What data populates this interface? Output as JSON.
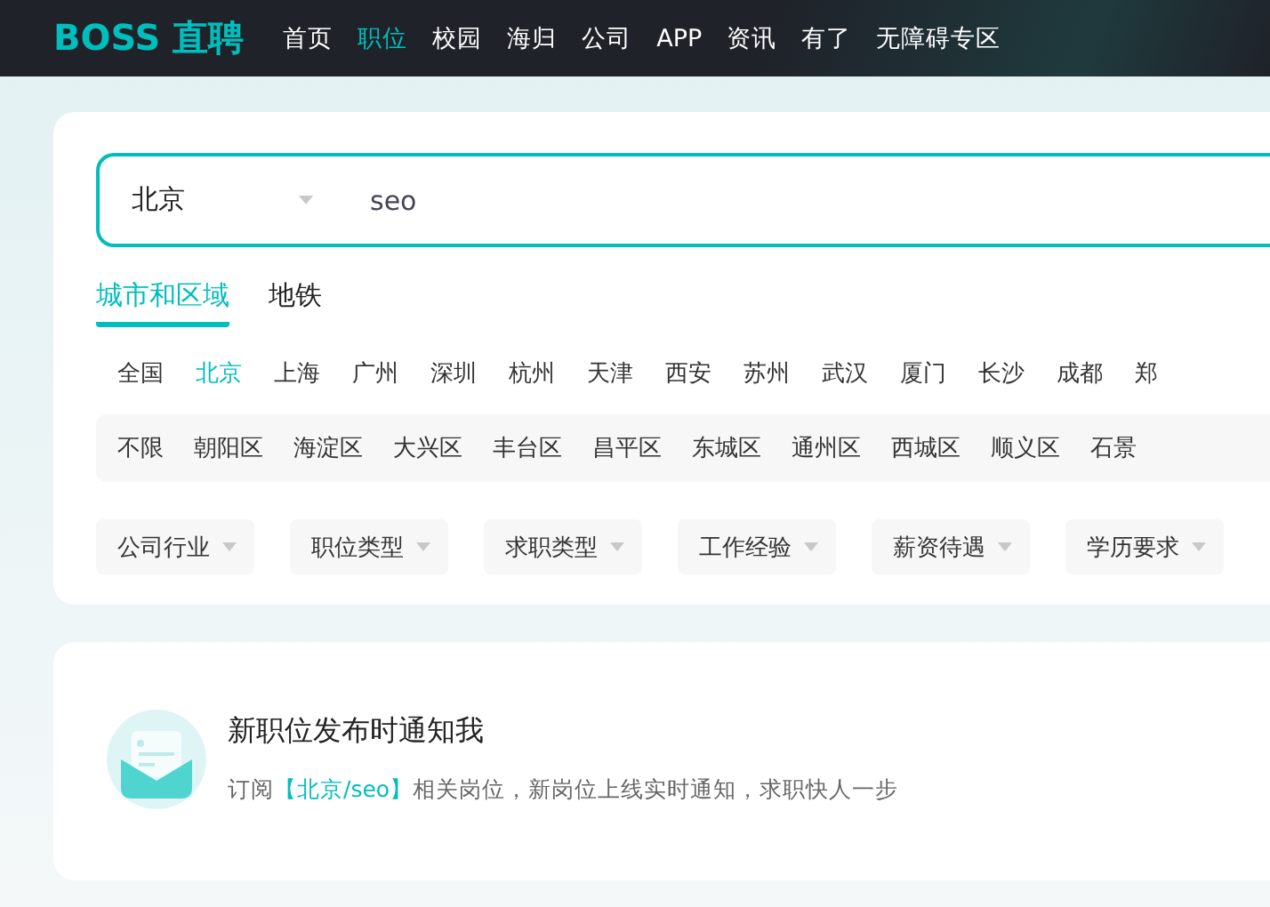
{
  "header": {
    "logo": "BOSS 直聘",
    "nav": [
      {
        "label": "首页",
        "selected": false
      },
      {
        "label": "职位",
        "selected": true
      },
      {
        "label": "校园",
        "selected": false
      },
      {
        "label": "海归",
        "selected": false
      },
      {
        "label": "公司",
        "selected": false
      },
      {
        "label": "APP",
        "selected": false
      },
      {
        "label": "资讯",
        "selected": false
      },
      {
        "label": "有了",
        "selected": false
      },
      {
        "label": "无障碍专区",
        "selected": false
      }
    ]
  },
  "search": {
    "city": "北京",
    "value": "seo"
  },
  "tabs": [
    {
      "label": "城市和区域",
      "selected": true
    },
    {
      "label": "地铁",
      "selected": false
    }
  ],
  "cities": [
    {
      "label": "全国",
      "selected": false
    },
    {
      "label": "北京",
      "selected": true
    },
    {
      "label": "上海",
      "selected": false
    },
    {
      "label": "广州",
      "selected": false
    },
    {
      "label": "深圳",
      "selected": false
    },
    {
      "label": "杭州",
      "selected": false
    },
    {
      "label": "天津",
      "selected": false
    },
    {
      "label": "西安",
      "selected": false
    },
    {
      "label": "苏州",
      "selected": false
    },
    {
      "label": "武汉",
      "selected": false
    },
    {
      "label": "厦门",
      "selected": false
    },
    {
      "label": "长沙",
      "selected": false
    },
    {
      "label": "成都",
      "selected": false
    },
    {
      "label": "郑",
      "selected": false
    }
  ],
  "districts": [
    "不限",
    "朝阳区",
    "海淀区",
    "大兴区",
    "丰台区",
    "昌平区",
    "东城区",
    "通州区",
    "西城区",
    "顺义区",
    "石景"
  ],
  "filters": [
    "公司行业",
    "职位类型",
    "求职类型",
    "工作经验",
    "薪资待遇",
    "学历要求"
  ],
  "subscribe": {
    "title": "新职位发布时通知我",
    "text_before": "订阅",
    "highlight": "【北京/seo】",
    "text_after": "相关岗位，新岗位上线实时通知，求职快人一步"
  }
}
